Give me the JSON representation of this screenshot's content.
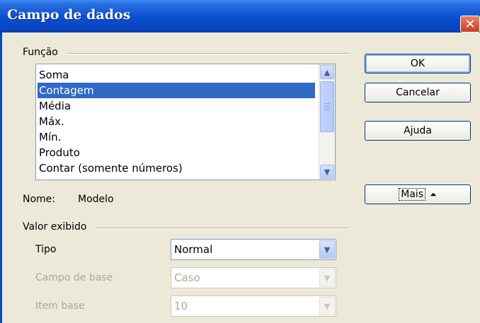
{
  "window": {
    "title": "Campo de dados",
    "close_icon": "close-icon"
  },
  "funcao": {
    "label": "Função",
    "items": [
      "Soma",
      "Contagem",
      "Média",
      "Máx.",
      "Mín.",
      "Produto",
      "Contar (somente números)"
    ],
    "selected_index": 1
  },
  "buttons": {
    "ok": "OK",
    "cancelar": "Cancelar",
    "ajuda": "Ajuda",
    "mais": "Mais"
  },
  "nome": {
    "label": "Nome:",
    "value": "Modelo"
  },
  "valor_exibido": {
    "label": "Valor exibido",
    "tipo": {
      "label": "Tipo",
      "value": "Normal"
    },
    "campo_de_base": {
      "label": "Campo de base",
      "value": "Caso"
    },
    "item_base": {
      "label": "Item base",
      "value": "10"
    }
  },
  "colors": {
    "titlebar": "#0a4fd0",
    "selection": "#316ac5",
    "dialog_bg": "#ece9d8"
  }
}
